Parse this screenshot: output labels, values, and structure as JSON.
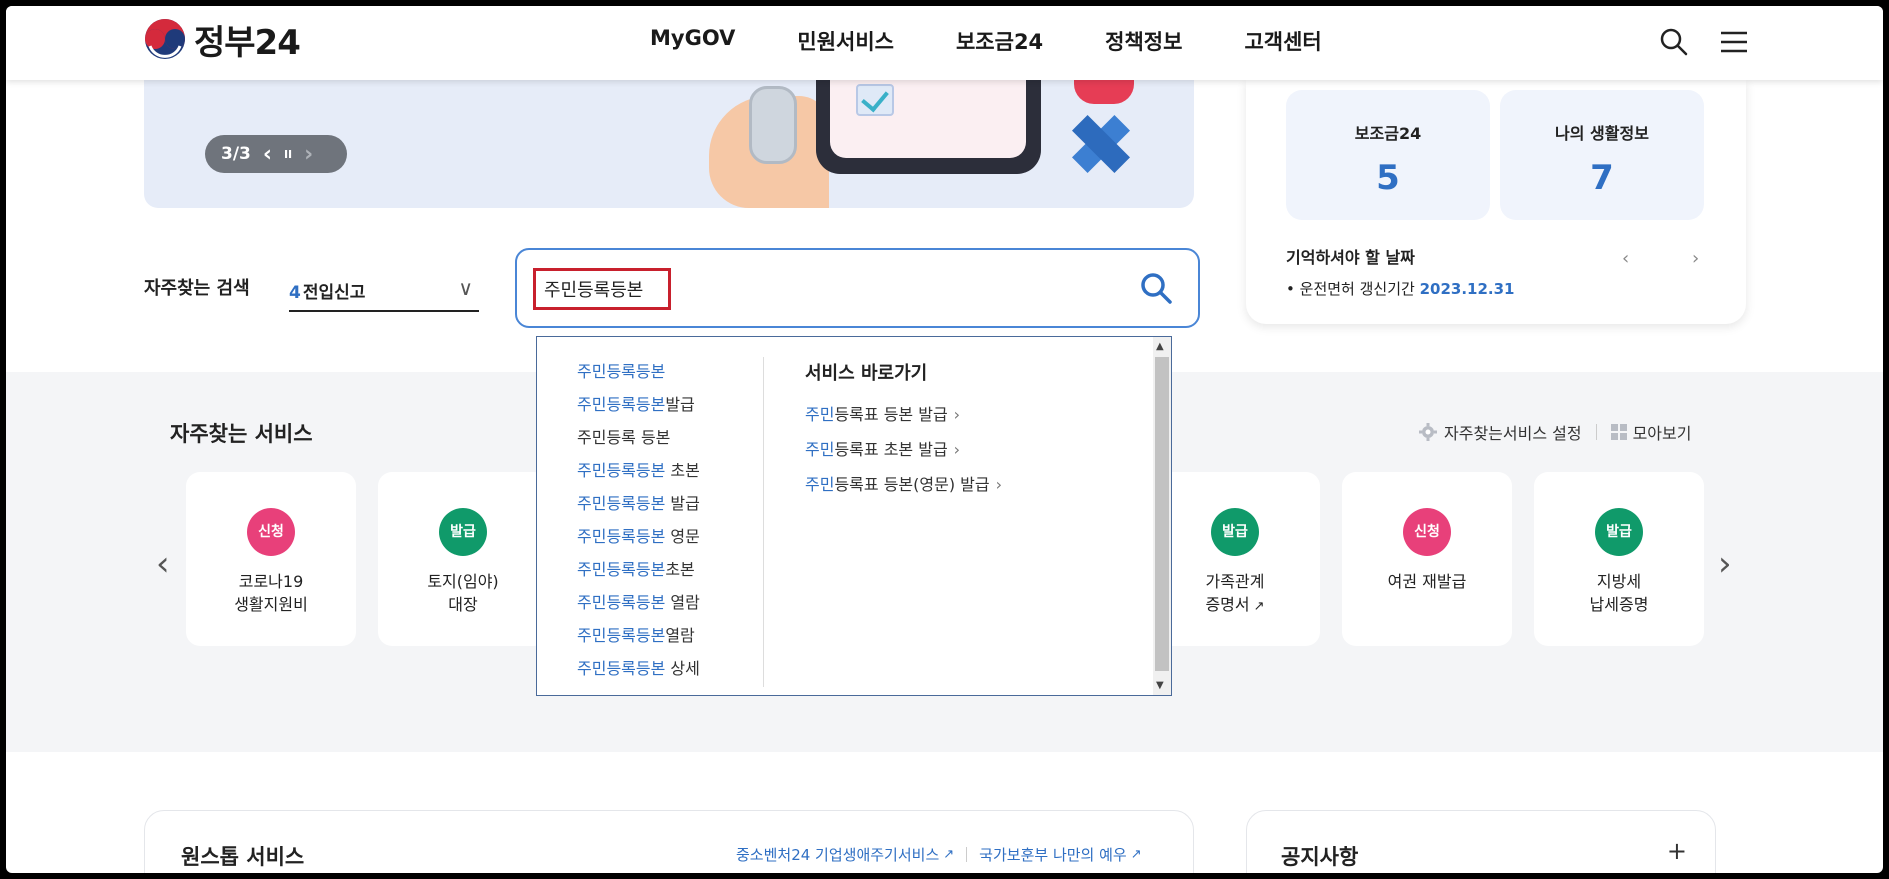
{
  "header": {
    "logo_text": "정부24",
    "nav": [
      "MyGOV",
      "민원서비스",
      "보조금24",
      "정책정보",
      "고객센터"
    ]
  },
  "banner": {
    "pager": "3/3",
    "prev": "‹",
    "pause": "II",
    "next": "›"
  },
  "right_panel": {
    "stats": [
      {
        "title": "보조금24",
        "value": "5"
      },
      {
        "title": "나의 생활정보",
        "value": "7"
      }
    ],
    "reminder_title": "기억하셔야 할 날짜",
    "reminder_bullet": "•",
    "reminder_item": "운전면허 갱신기간",
    "reminder_date": "2023.12.31"
  },
  "frequent_search": {
    "label": "자주찾는 검색",
    "selected_num": "4",
    "selected_text": "전입신고"
  },
  "search": {
    "value": "주민등록등본"
  },
  "autocomplete": {
    "suggestions": [
      {
        "hl": "주민등록등본",
        "rest": ""
      },
      {
        "hl": "주민등록등본",
        "rest": "발급"
      },
      {
        "hl": "",
        "rest": "주민등록 등본"
      },
      {
        "hl": "주민등록등본",
        "rest": " 초본"
      },
      {
        "hl": "주민등록등본",
        "rest": " 발급"
      },
      {
        "hl": "주민등록등본",
        "rest": " 영문"
      },
      {
        "hl": "주민등록등본",
        "rest": "초본"
      },
      {
        "hl": "주민등록등본",
        "rest": " 열람"
      },
      {
        "hl": "주민등록등본",
        "rest": "열람"
      },
      {
        "hl": "주민등록등본",
        "rest": " 상세"
      }
    ],
    "shortcut_title": "서비스 바로가기",
    "shortcuts": [
      {
        "hl": "주민",
        "rest": "등록표 등본 발급"
      },
      {
        "hl": "주민",
        "rest": "등록표 초본 발급"
      },
      {
        "hl": "주민",
        "rest": "등록표 등본(영문) 발급"
      }
    ],
    "arrow": "›"
  },
  "services": {
    "title": "자주찾는 서비스",
    "settings_label": "자주찾는서비스 설정",
    "view_all_label": "모아보기",
    "cards": [
      {
        "badge": "신청",
        "label": "코로나19\n생활지원비",
        "color": "pink"
      },
      {
        "badge": "발급",
        "label": "토지(임야)\n대장",
        "color": "green"
      },
      {
        "badge": "발급",
        "label": "가족관계\n증명서",
        "color": "green",
        "external": true
      },
      {
        "badge": "신청",
        "label": "여권 재발급",
        "color": "pink"
      },
      {
        "badge": "발급",
        "label": "지방세\n납세증명",
        "color": "green"
      }
    ],
    "prev": "‹",
    "next": "›"
  },
  "onestop": {
    "title": "원스톱 서비스",
    "links": [
      "중소벤처24 기업생애주기서비스",
      "국가보훈부 나만의 예우"
    ]
  },
  "notice": {
    "title": "공지사항",
    "plus": "+"
  },
  "colors": {
    "accent": "#2f6fc3",
    "highlight_box": "#c8202d",
    "badge_pink": "#e8407a",
    "badge_green": "#109a6a"
  }
}
